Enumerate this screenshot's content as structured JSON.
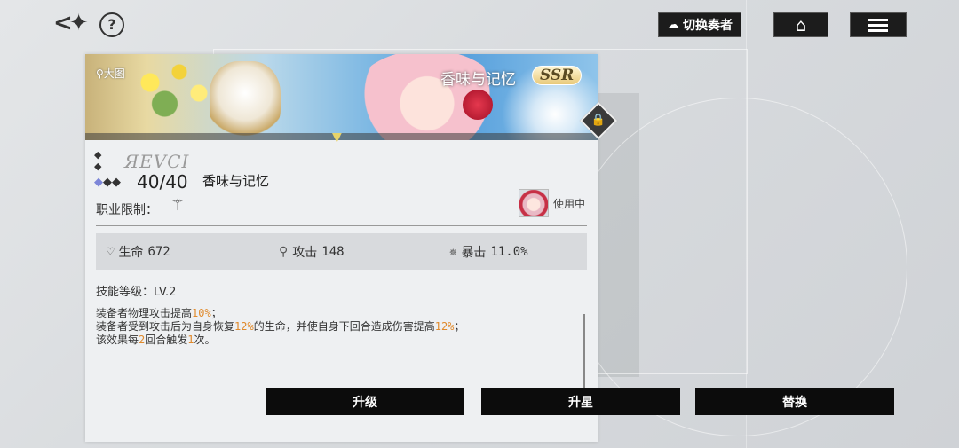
{
  "topbar": {
    "switch_label": "切换奏者"
  },
  "card": {
    "big_image_label": "大图",
    "banner_title": "香味与记忆",
    "rarity": "SSR",
    "logo_text": "ЯЕVCI",
    "level": "40/40",
    "name": "香味与记忆",
    "job_limit_label": "职业限制：",
    "in_use_label": "使用中",
    "stats": {
      "hp_label": "生命",
      "hp_value": "672",
      "atk_label": "攻击",
      "atk_value": "148",
      "crit_label": "暴击",
      "crit_value": "11.0%"
    },
    "skill_level": "技能等级：LV.2",
    "description": {
      "line1_a": "装备者物理攻击提高",
      "line1_hl": "10%",
      "line1_b": "；",
      "line2_a": "装备者受到攻击后为自身恢复",
      "line2_hl1": "12%",
      "line2_b": "的生命，并使自身下回合造成伤害提高",
      "line2_hl2": "12%",
      "line2_c": "；",
      "line3_a": "该效果每",
      "line3_hl1": "2",
      "line3_b": "回合触发",
      "line3_hl2": "1",
      "line3_c": "次。"
    }
  },
  "actions": {
    "upgrade": "升级",
    "star_up": "升星",
    "replace": "替换"
  },
  "colors": {
    "highlight": "#e08a2c",
    "button_bg": "#0c0c0c"
  }
}
